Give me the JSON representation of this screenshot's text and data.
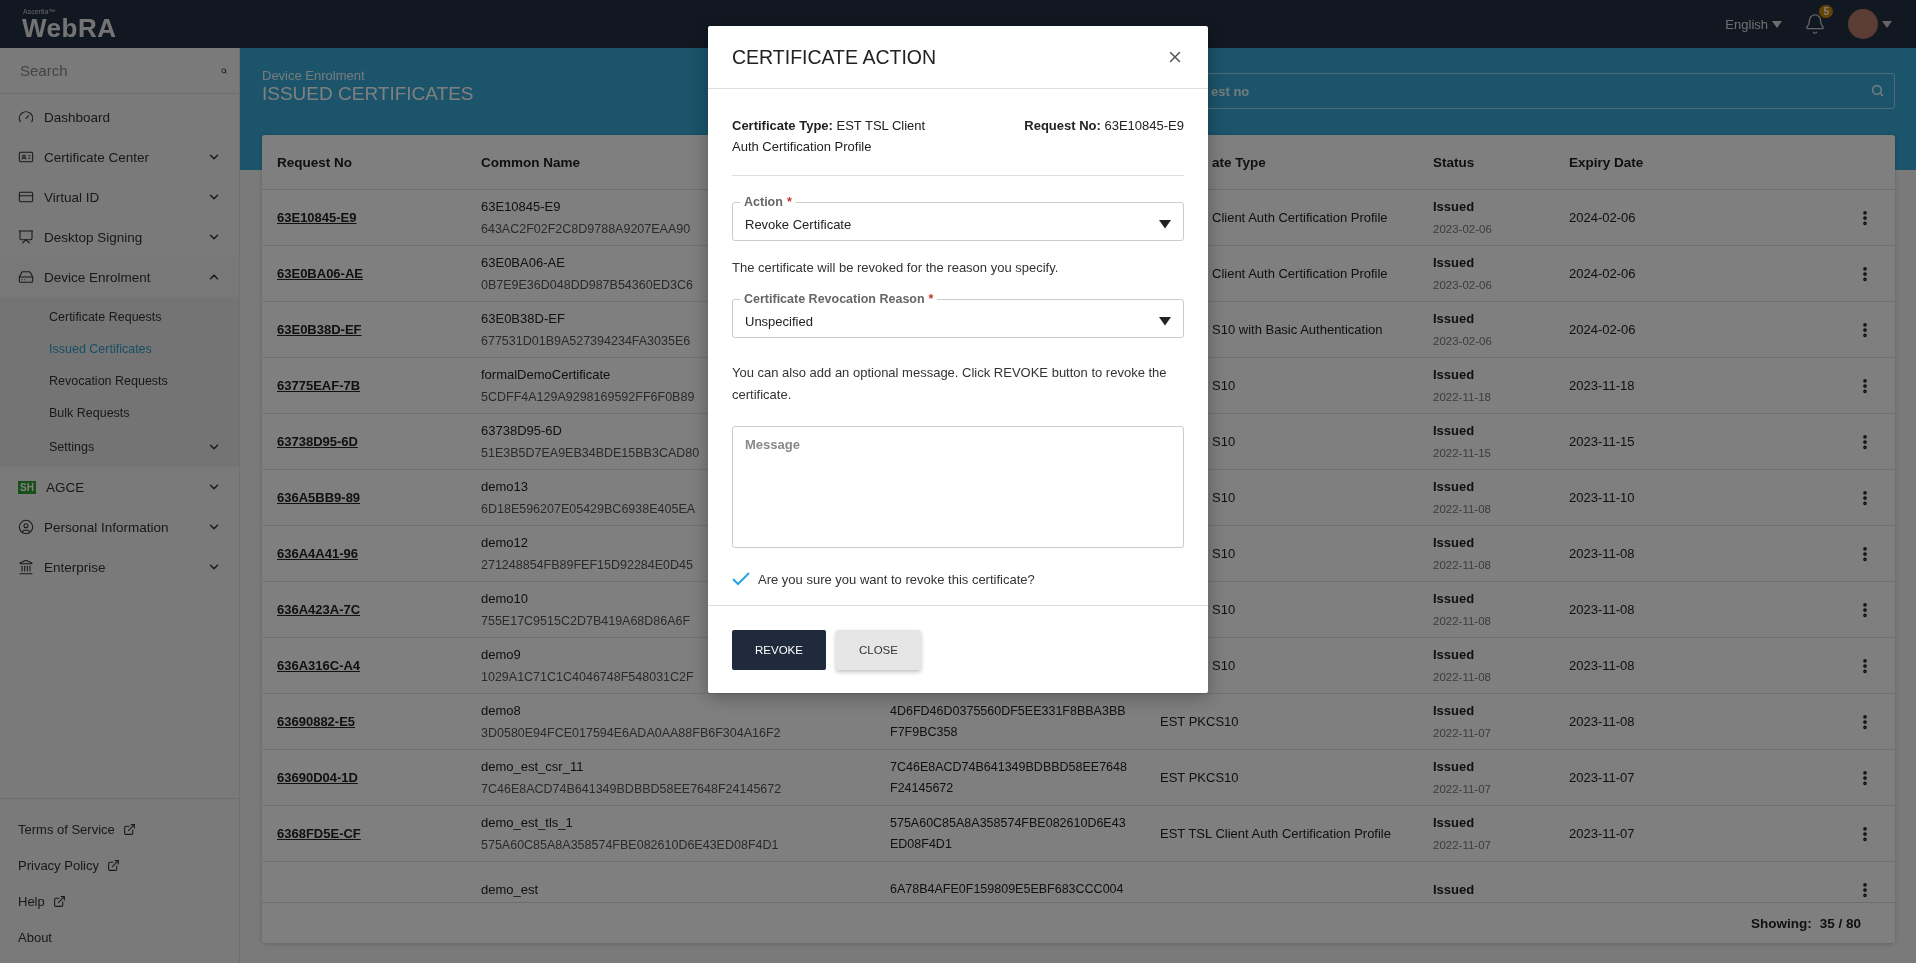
{
  "header": {
    "brand": "Ascertia™",
    "app_name": "WebRA",
    "language": "English",
    "notification_count": "5"
  },
  "sidebar": {
    "search": {
      "placeholder": "Search"
    },
    "items": [
      {
        "label": "Dashboard"
      },
      {
        "label": "Certificate Center",
        "expanded": false
      },
      {
        "label": "Virtual ID",
        "expanded": false
      },
      {
        "label": "Desktop Signing",
        "expanded": false
      },
      {
        "label": "Device Enrolment",
        "expanded": true,
        "children": [
          {
            "label": "Certificate Requests",
            "selected": false
          },
          {
            "label": "Issued Certificates",
            "selected": true
          },
          {
            "label": "Revocation Requests",
            "selected": false
          },
          {
            "label": "Bulk Requests",
            "selected": false
          },
          {
            "label": "Settings",
            "selected": false,
            "expanded": false
          }
        ]
      },
      {
        "label": "AGCE",
        "icon_text": "SH",
        "expanded": false
      },
      {
        "label": "Personal Information",
        "expanded": false
      },
      {
        "label": "Enterprise",
        "expanded": false
      }
    ],
    "footer_links": [
      {
        "label": "Terms of Service",
        "external": true
      },
      {
        "label": "Privacy Policy",
        "external": true
      },
      {
        "label": "Help",
        "external": true
      },
      {
        "label": "About",
        "external": false
      }
    ]
  },
  "page": {
    "breadcrumb": "Device Enrolment",
    "title": "ISSUED CERTIFICATES",
    "search": {
      "placeholder": "est no"
    }
  },
  "table": {
    "columns": [
      {
        "label": "Request No"
      },
      {
        "label": "Common Name"
      },
      {
        "label": "ate Type",
        "behind_dialog": true
      },
      {
        "label": "Status"
      },
      {
        "label": "Expiry Date"
      }
    ],
    "rows": [
      {
        "request_no": "63E10845-E9",
        "common_name": "63E10845-E9",
        "fingerprint": "643AC2F02F2C8D9788A9207EAA90",
        "certificate_type": "Client Auth Certification Profile",
        "status": "Issued",
        "issued_date": "2023-02-06",
        "expiry_date": "2024-02-06",
        "behind_dialog": true
      },
      {
        "request_no": "63E0BA06-AE",
        "common_name": "63E0BA06-AE",
        "fingerprint": "0B7E9E36D048DD987B54360ED3C6",
        "certificate_type": "Client Auth Certification Profile",
        "status": "Issued",
        "issued_date": "2023-02-06",
        "expiry_date": "2024-02-06",
        "behind_dialog": true
      },
      {
        "request_no": "63E0B38D-EF",
        "common_name": "63E0B38D-EF",
        "fingerprint": "677531D01B9A527394234FA3035E6",
        "certificate_type": "S10 with Basic Authentication",
        "status": "Issued",
        "issued_date": "2023-02-06",
        "expiry_date": "2024-02-06",
        "behind_dialog": true
      },
      {
        "request_no": "63775EAF-7B",
        "common_name": "formalDemoCertificate",
        "fingerprint": "5CDFF4A129A9298169592FF6F0B89",
        "certificate_type": "S10",
        "status": "Issued",
        "issued_date": "2022-11-18",
        "expiry_date": "2023-11-18",
        "behind_dialog": true
      },
      {
        "request_no": "63738D95-6D",
        "common_name": "63738D95-6D",
        "fingerprint": "51E3B5D7EA9EB34BDE15BB3CAD80",
        "certificate_type": "S10",
        "status": "Issued",
        "issued_date": "2022-11-15",
        "expiry_date": "2023-11-15",
        "behind_dialog": true
      },
      {
        "request_no": "636A5BB9-89",
        "common_name": "demo13",
        "fingerprint": "6D18E596207E05429BC6938E405EA",
        "certificate_type": "S10",
        "status": "Issued",
        "issued_date": "2022-11-08",
        "expiry_date": "2023-11-10",
        "behind_dialog": true
      },
      {
        "request_no": "636A4A41-96",
        "common_name": "demo12",
        "fingerprint": "271248854FB89FEF15D92284E0D45",
        "certificate_type": "S10",
        "status": "Issued",
        "issued_date": "2022-11-08",
        "expiry_date": "2023-11-08",
        "behind_dialog": true
      },
      {
        "request_no": "636A423A-7C",
        "common_name": "demo10",
        "fingerprint": "755E17C9515C2D7B419A68D86A6F",
        "certificate_type": "S10",
        "status": "Issued",
        "issued_date": "2022-11-08",
        "expiry_date": "2023-11-08",
        "behind_dialog": true
      },
      {
        "request_no": "636A316C-A4",
        "common_name": "demo9",
        "fingerprint": "1029A1C71C1C4046748F548031C2F",
        "certificate_type": "S10",
        "status": "Issued",
        "issued_date": "2022-11-08",
        "expiry_date": "2023-11-08",
        "behind_dialog": true
      },
      {
        "request_no": "63690882-E5",
        "common_name": "demo8",
        "fingerprint": "3D0580E94FCE017594E6ADA0AA88FB6F304A16F2",
        "column_3": "4D6FD46D0375560DF5EE331F8BBA3BBF7F9BC358",
        "certificate_type": "EST PKCS10",
        "status": "Issued",
        "issued_date": "2022-11-07",
        "expiry_date": "2023-11-08"
      },
      {
        "request_no": "63690D04-1D",
        "common_name": "demo_est_csr_11",
        "fingerprint": "7C46E8ACD74B641349BDBBD58EE7648F24145672",
        "column_3": "7C46E8ACD74B641349BDBBD58EE7648F24145672",
        "certificate_type": "EST PKCS10",
        "status": "Issued",
        "issued_date": "2022-11-07",
        "expiry_date": "2023-11-07"
      },
      {
        "request_no": "6368FD5E-CF",
        "common_name": "demo_est_tls_1",
        "fingerprint": "575A60C85A8A358574FBE082610D6E43ED08F4D1",
        "column_3": "575A60C85A8A358574FBE082610D6E43ED08F4D1",
        "certificate_type": "EST TSL Client Auth Certification Profile",
        "status": "Issued",
        "issued_date": "2022-11-07",
        "expiry_date": "2023-11-07"
      },
      {
        "common_name": "demo_est",
        "column_3": "6A78B4AFE0F159809E5EBF683CCC004",
        "status": "Issued"
      }
    ],
    "footer": {
      "label": "Showing:",
      "count": "35 / 80"
    }
  },
  "dialog": {
    "title": "CERTIFICATE ACTION",
    "certificate_type": "**Certificate Type:** EST TSL Client Auth Certification Profile",
    "request_no": "**Request No:** 63E10845-E9",
    "action": {
      "label": "Action",
      "required_mark": "*",
      "value": "Revoke Certificate"
    },
    "reason_note": "The certificate will be revoked for the reason you specify.",
    "reason": {
      "label": "Certificate Revocation Reason",
      "required_mark": "*",
      "value": "Unspecified"
    },
    "message_note": "You can also add an optional message. Click REVOKE button to revoke the certificate.",
    "message": {
      "placeholder": "Message"
    },
    "confirm": {
      "label": "Are you sure you want to revoke this certificate?",
      "checked": true
    },
    "buttons": [
      {
        "label": "REVOKE",
        "kind": "primary"
      },
      {
        "label": "CLOSE",
        "kind": "secondary"
      }
    ]
  }
}
